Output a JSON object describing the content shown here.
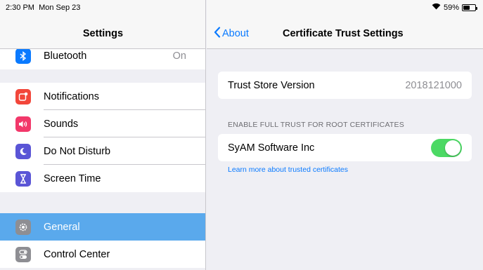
{
  "status_bar": {
    "time": "2:30 PM",
    "date": "Mon Sep 23",
    "battery_text": "59%",
    "battery_level": 0.59
  },
  "settings": {
    "title": "Settings",
    "partial_row": {
      "label": "Bluetooth",
      "value": "On"
    },
    "group1": [
      {
        "label": "Notifications",
        "icon": "notifications-icon",
        "color": "#f2463a"
      },
      {
        "label": "Sounds",
        "icon": "sounds-icon",
        "color": "#f2386a"
      },
      {
        "label": "Do Not Disturb",
        "icon": "moon-icon",
        "color": "#5a55d6"
      },
      {
        "label": "Screen Time",
        "icon": "hourglass-icon",
        "color": "#5a55d6"
      }
    ],
    "group2": [
      {
        "label": "General",
        "icon": "gear-icon",
        "color": "#8e8e93",
        "selected": true
      },
      {
        "label": "Control Center",
        "icon": "toggles-icon",
        "color": "#8e8e93"
      }
    ]
  },
  "detail": {
    "back_label": "About",
    "title": "Certificate Trust Settings",
    "trust_store": {
      "label": "Trust Store Version",
      "value": "2018121000"
    },
    "section_header": "ENABLE FULL TRUST FOR ROOT CERTIFICATES",
    "certificate": {
      "label": "SyAM Software Inc",
      "enabled": true
    },
    "link": "Learn more about trusted certificates"
  },
  "colors": {
    "accent": "#0a7aff",
    "selected_row": "#5aa9ec",
    "toggle_on": "#4cd964"
  }
}
